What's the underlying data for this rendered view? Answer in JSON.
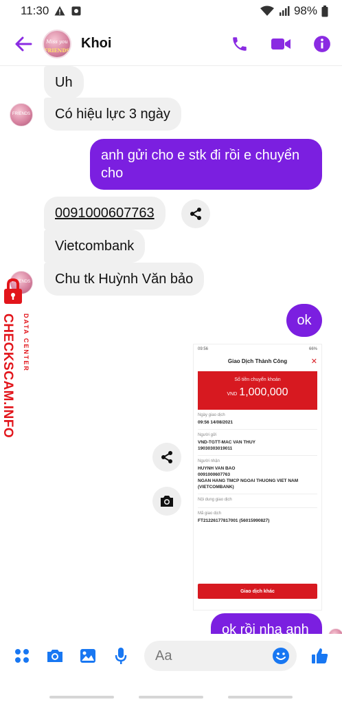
{
  "status_bar": {
    "time": "11:30",
    "battery": "98%"
  },
  "header": {
    "contact_name": "Khoi",
    "avatar_line1": "Miss you",
    "avatar_line2": "FRIENDS"
  },
  "messages": [
    {
      "dir": "received",
      "text": "Uh"
    },
    {
      "dir": "received",
      "text": "Có hiệu lực 3 ngày"
    },
    {
      "dir": "sent",
      "text": "anh gửi cho e stk đi rồi e chuyển cho"
    },
    {
      "dir": "received",
      "text": "0091000607763"
    },
    {
      "dir": "received",
      "text": "Vietcombank"
    },
    {
      "dir": "received",
      "text": "Chu tk Huỳnh Văn bảo"
    },
    {
      "dir": "sent",
      "text": "ok"
    },
    {
      "dir": "sent",
      "text": "ok rồi nha anh"
    }
  ],
  "attachment": {
    "status_time": "09:56",
    "status_battery": "66%",
    "title": "Giao Dịch Thành Công",
    "amount_label": "Số tiền chuyển khoản",
    "currency": "VND",
    "amount": "1,000,000",
    "fields": [
      {
        "label": "Ngày giao dịch",
        "value": "09:56 14/08/2021"
      },
      {
        "label": "Người gửi",
        "value": "VND-TGTT-MAC VAN THUY\n19030303019011"
      },
      {
        "label": "Người nhận",
        "value": "HUYNH VAN BAO\n0091000607763\nNGAN HANG TMCP NGOAI THUONG VIET NAM\n(VIETCOMBANK)"
      },
      {
        "label": "Nội dung giao dịch",
        "value": ""
      },
      {
        "label": "Mã giao dịch",
        "value": "FT21226177817001 (56015990827)"
      }
    ],
    "button_label": "Giao dịch khác"
  },
  "watermark": {
    "main": "CHECKSCAM.INFO",
    "sub": "DATA CENTER"
  },
  "composer": {
    "placeholder": "Aa"
  },
  "colors": {
    "accent": "#7b1fe0",
    "composer_blue": "#1877f2",
    "bank_red": "#d71920"
  }
}
